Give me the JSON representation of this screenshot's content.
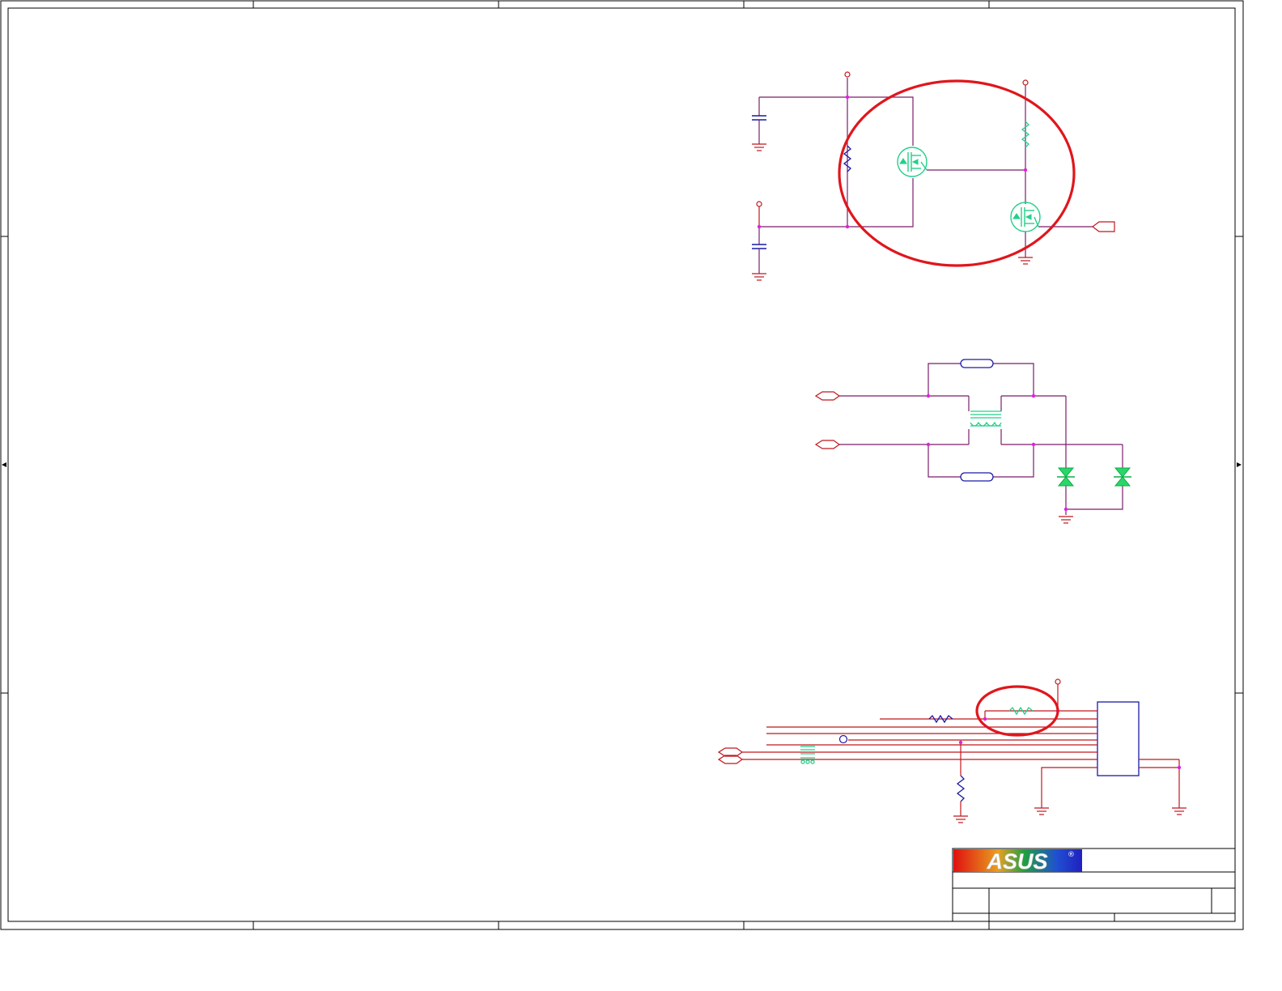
{
  "schematic": {
    "logo": {
      "text": "ASUS",
      "registered_mark": "®"
    },
    "title_block": {
      "title": "",
      "sheet": ""
    },
    "colors": {
      "wire": "#7a1f6b",
      "ground_and_ports": "#c0181e",
      "passive_blue": "#1a1aa8",
      "active_green": "#22d08a",
      "junction": "#e020e0",
      "highlight_circle": "#e0161c"
    },
    "icons": [
      "resistor-icon",
      "capacitor-icon",
      "mosfet-icon",
      "ground-icon",
      "power-pin-icon",
      "port-connector-icon",
      "tvs-diode-icon",
      "transformer-icon",
      "fuse-icon",
      "ic-chip-icon"
    ]
  }
}
